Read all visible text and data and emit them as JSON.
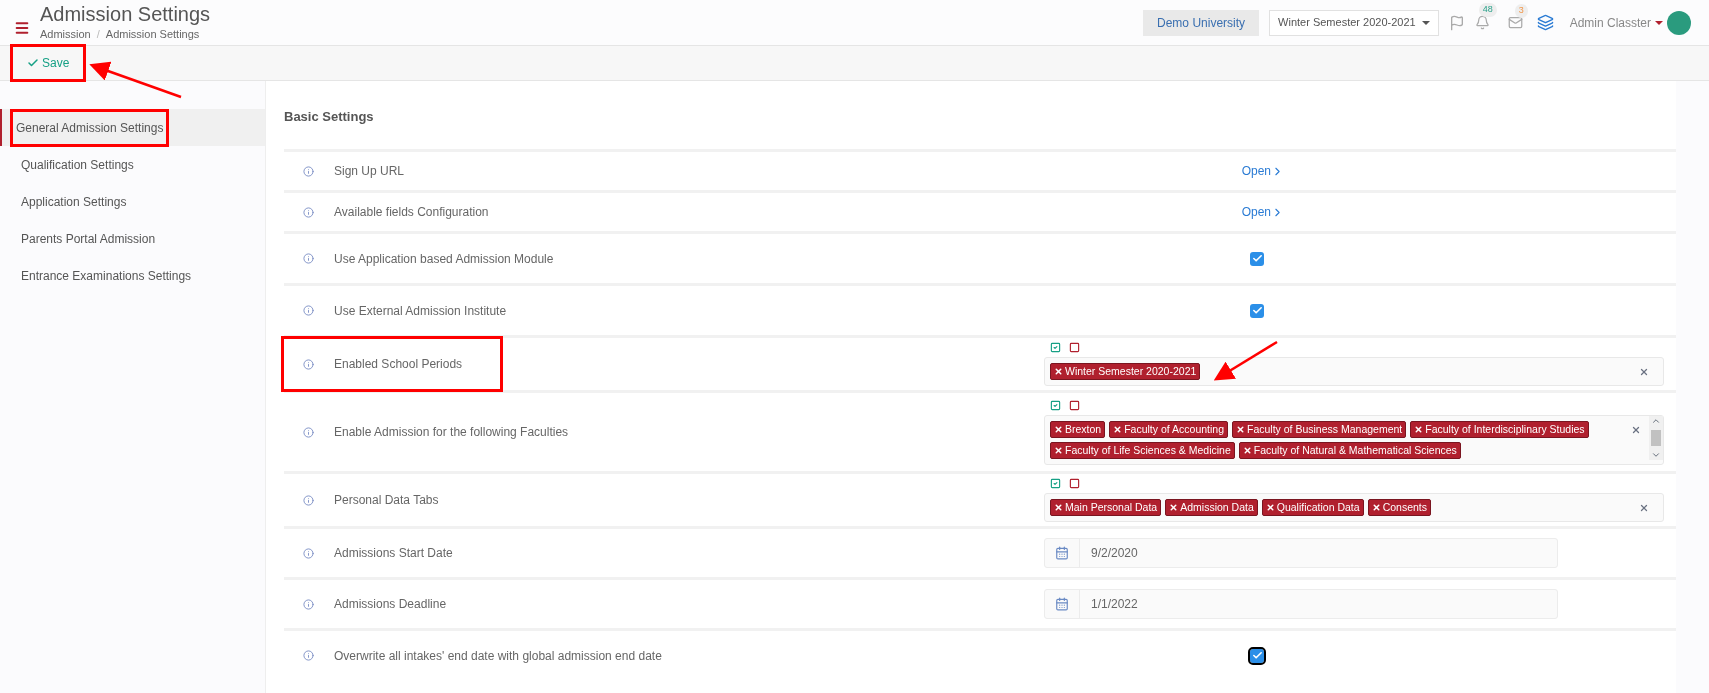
{
  "header": {
    "title": "Admission Settings",
    "breadcrumb": [
      "Admission",
      "Admission Settings"
    ],
    "breadcrumb_separator": "/",
    "institution": "Demo University",
    "period": "Winter Semester 2020-2021",
    "notifications": "48",
    "messages": "3",
    "user": "Admin Classter"
  },
  "toolbar": {
    "save": "Save",
    "annotated": true
  },
  "sidebar": [
    {
      "label": "General Admission Settings",
      "selected": true,
      "annotated": true
    },
    {
      "label": "Qualification Settings",
      "selected": false,
      "annotated": false
    },
    {
      "label": "Application Settings",
      "selected": false,
      "annotated": false
    },
    {
      "label": "Parents Portal Admission",
      "selected": false,
      "annotated": false
    },
    {
      "label": "Entrance Examinations Settings",
      "selected": false,
      "annotated": false
    }
  ],
  "section_title": "Basic Settings",
  "settings": [
    {
      "label": "Sign Up URL",
      "kind": "link",
      "value": "Open",
      "annotated": false
    },
    {
      "label": "Available fields Configuration",
      "kind": "link",
      "value": "Open",
      "annotated": false
    },
    {
      "label": "Use Application based Admission Module",
      "kind": "checkbox",
      "checked": true,
      "focused": false,
      "annotated": false
    },
    {
      "label": "Use External Admission Institute",
      "kind": "checkbox",
      "checked": true,
      "focused": false,
      "annotated": false
    },
    {
      "label": "Enabled School Periods",
      "kind": "tags",
      "scrollable": false,
      "tags": [
        "Winter Semester 2020-2021"
      ],
      "annotated": true
    },
    {
      "label": "Enable Admission for the following Faculties",
      "kind": "tags",
      "scrollable": true,
      "tags": [
        "Brexton",
        "Faculty of Accounting",
        "Faculty of Business Management",
        "Faculty of Interdisciplinary Studies",
        "Faculty of Life Sciences & Medicine",
        "Faculty of Natural & Mathematical Sciences"
      ],
      "annotated": false
    },
    {
      "label": "Personal Data Tabs",
      "kind": "tags",
      "scrollable": false,
      "tags": [
        "Main Personal Data",
        "Admission Data",
        "Qualification Data",
        "Consents"
      ],
      "annotated": false
    },
    {
      "label": "Admissions Start Date",
      "kind": "date",
      "value": "9/2/2020",
      "annotated": false
    },
    {
      "label": "Admissions Deadline",
      "kind": "date",
      "value": "1/1/2022",
      "annotated": false
    },
    {
      "label": "Overwrite all intakes' end date with global admission end date",
      "kind": "checkbox",
      "checked": true,
      "focused": true,
      "annotated": false
    }
  ]
}
